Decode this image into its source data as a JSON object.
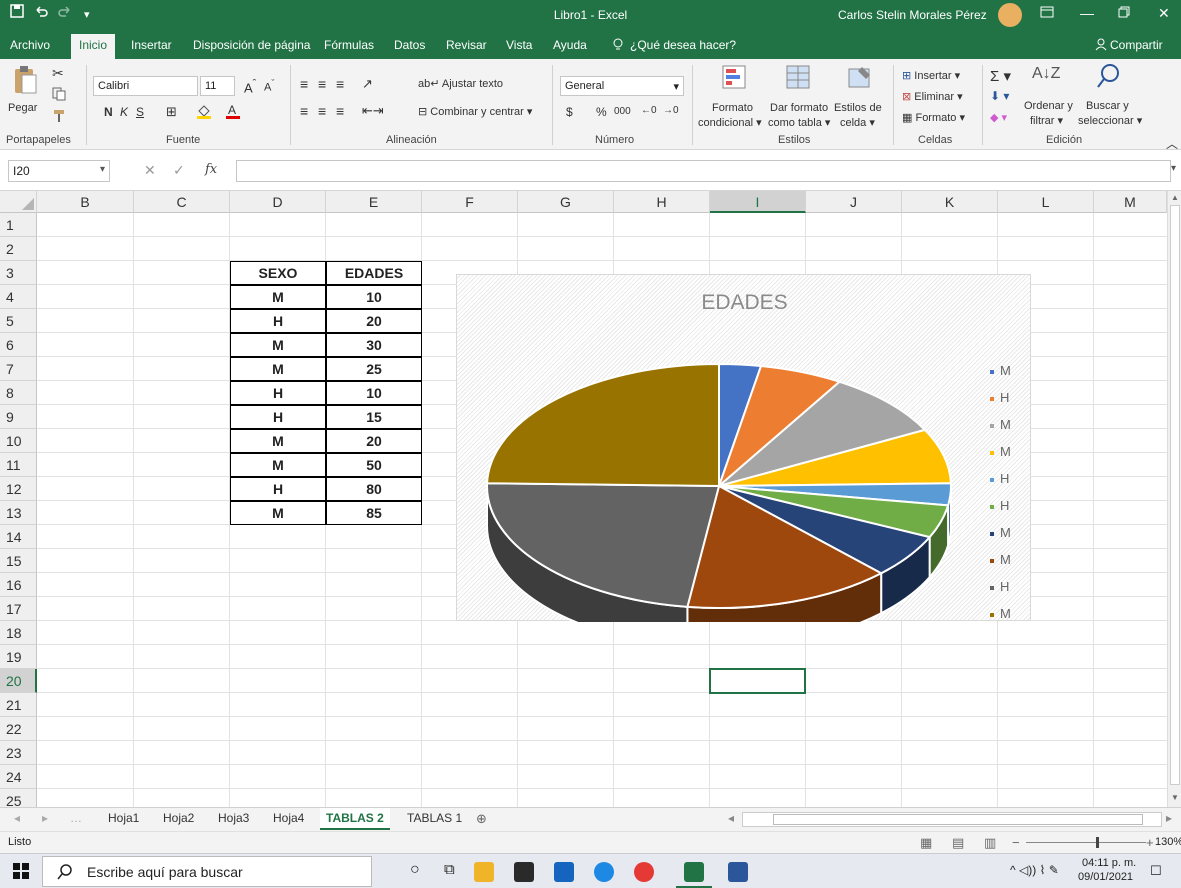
{
  "title_bar": {
    "title": "Libro1  -  Excel",
    "user": "Carlos Stelin Morales Pérez",
    "save_icon": "floppy-disk-icon",
    "undo_icon": "undo-icon",
    "redo_icon": "redo-icon"
  },
  "menu": {
    "items": [
      "Archivo",
      "Inicio",
      "Insertar",
      "Disposición de página",
      "Fórmulas",
      "Datos",
      "Revisar",
      "Vista",
      "Ayuda"
    ],
    "active": "Inicio",
    "tell_me": "¿Qué desea hacer?",
    "share": "Compartir"
  },
  "ribbon": {
    "paste": "Pegar",
    "font_name": "Calibri",
    "font_size": "11",
    "bold": "N",
    "italic": "K",
    "underline": "S",
    "wrap_text": "Ajustar texto",
    "merge_center": "Combinar y centrar",
    "number_format": "General",
    "currency": "$",
    "percent": "%",
    "thousands": "000",
    "cond_format_1": "Formato",
    "cond_format_2": "condicional",
    "format_table_1": "Dar formato",
    "format_table_2": "como tabla",
    "cell_styles_1": "Estilos de",
    "cell_styles_2": "celda",
    "insert": "Insertar",
    "delete": "Eliminar",
    "format": "Formato",
    "sort_1": "Ordenar y",
    "sort_2": "filtrar",
    "find_1": "Buscar y",
    "find_2": "seleccionar",
    "groups": [
      "Portapapeles",
      "Fuente",
      "Alineación",
      "Número",
      "Estilos",
      "Celdas",
      "Edición"
    ]
  },
  "formula_bar": {
    "name_box": "I20",
    "fx": "fx",
    "value": ""
  },
  "columns": [
    "B",
    "C",
    "D",
    "E",
    "F",
    "G",
    "H",
    "I",
    "J",
    "K",
    "L",
    "M"
  ],
  "selected_column": "I",
  "rows": [
    "1",
    "2",
    "3",
    "4",
    "5",
    "6",
    "7",
    "8",
    "9",
    "10",
    "11",
    "12",
    "13",
    "14",
    "15",
    "16",
    "17",
    "18",
    "19",
    "20",
    "21",
    "22",
    "23",
    "24",
    "25"
  ],
  "selected_row": "20",
  "table": {
    "headers": [
      "SEXO",
      "EDADES"
    ],
    "rows": [
      [
        "M",
        "10"
      ],
      [
        "H",
        "20"
      ],
      [
        "M",
        "30"
      ],
      [
        "M",
        "25"
      ],
      [
        "H",
        "10"
      ],
      [
        "H",
        "15"
      ],
      [
        "M",
        "20"
      ],
      [
        "M",
        "50"
      ],
      [
        "H",
        "80"
      ],
      [
        "M",
        "85"
      ]
    ]
  },
  "chart_data": {
    "type": "pie",
    "title": "EDADES",
    "categories": [
      "M",
      "H",
      "M",
      "M",
      "H",
      "H",
      "M",
      "M",
      "H",
      "M"
    ],
    "values": [
      10,
      20,
      30,
      25,
      10,
      15,
      20,
      50,
      80,
      85
    ],
    "colors": [
      "#4472c4",
      "#ed7d31",
      "#a5a5a5",
      "#ffc000",
      "#5b9bd5",
      "#70ad47",
      "#264478",
      "#9e480e",
      "#636363",
      "#997300"
    ],
    "legend": "right",
    "three_d": true
  },
  "sheets": {
    "tabs": [
      "Hoja1",
      "Hoja2",
      "Hoja3",
      "Hoja4",
      "TABLAS 2",
      "TABLAS 1"
    ],
    "active": "TABLAS 2"
  },
  "status": {
    "mode": "Listo",
    "zoom": "130%"
  },
  "taskbar": {
    "search_placeholder": "Escribe aquí para buscar",
    "time": "04:11 p. m.",
    "date": "09/01/2021"
  }
}
